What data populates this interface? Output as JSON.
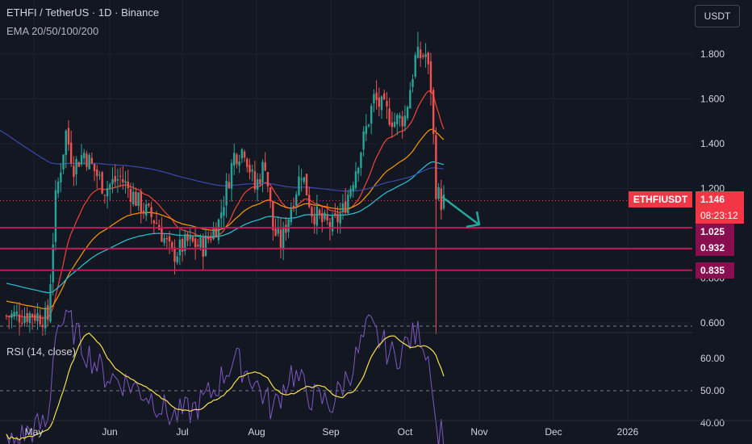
{
  "header": {
    "title": "ETHFI / TetherUS · 1D · Binance",
    "indicators": "EMA 20/50/100/200"
  },
  "currency_button": "USDT",
  "rsi": {
    "label": "RSI (14, close)"
  },
  "price_tags": {
    "symbol": "ETHFIUSDT",
    "last_price": "1.146",
    "countdown": "08:23:12"
  },
  "levels": [
    {
      "label": "1.025",
      "value": 1.025
    },
    {
      "label": "0.932",
      "value": 0.932
    },
    {
      "label": "0.835",
      "value": 0.835
    }
  ],
  "colors": {
    "background": "#131722",
    "up": "#26a69a",
    "down": "#ef5350",
    "level": "#c2185b",
    "arrow": "#26a69a",
    "rsi_line": "#7e57c2",
    "rsi_ma": "#f9e04b",
    "ema20": "#f44336",
    "ema50": "#ff9800",
    "ema100": "#26c6da",
    "ema200": "#3949ab"
  },
  "chart_data": [
    {
      "type": "candlestick",
      "price_axis_ticks": [
        "1.800",
        "1.600",
        "1.400",
        "1.200",
        "0.800",
        "0.600"
      ],
      "price_axis_values": [
        1.8,
        1.6,
        1.4,
        1.2,
        0.8,
        0.6
      ],
      "ylim": [
        0.54,
        1.93
      ],
      "time_axis_ticks": [
        "May",
        "Jun",
        "Jul",
        "Aug",
        "Sep",
        "Oct",
        "Nov",
        "Dec",
        "2026"
      ],
      "last_price": 1.146,
      "horizontal_levels": [
        1.025,
        0.932,
        0.835
      ],
      "series": [
        {
          "name": "EMA 20"
        },
        {
          "name": "EMA 50"
        },
        {
          "name": "EMA 100"
        },
        {
          "name": "EMA 200"
        }
      ],
      "key_points": [
        {
          "period": "early May",
          "price": 0.62
        },
        {
          "period": "mid May",
          "price": 1.35
        },
        {
          "period": "late Jun",
          "price": 0.9
        },
        {
          "period": "late Jul",
          "price": 1.35
        },
        {
          "period": "early Aug",
          "price": 0.95
        },
        {
          "period": "mid Sep",
          "price": 1.65
        },
        {
          "period": "early Oct",
          "price": 1.88
        },
        {
          "period": "Oct 10",
          "price": 0.55
        },
        {
          "period": "mid Oct",
          "price": 1.146
        }
      ]
    },
    {
      "type": "line",
      "title": "RSI (14, close)",
      "y_axis_ticks": [
        "60.00",
        "50.00",
        "40.00"
      ],
      "y_axis_values": [
        60,
        50,
        40
      ],
      "ylim": [
        30,
        75
      ],
      "guide_levels": [
        70,
        50,
        30
      ],
      "last_value": 37
    }
  ]
}
